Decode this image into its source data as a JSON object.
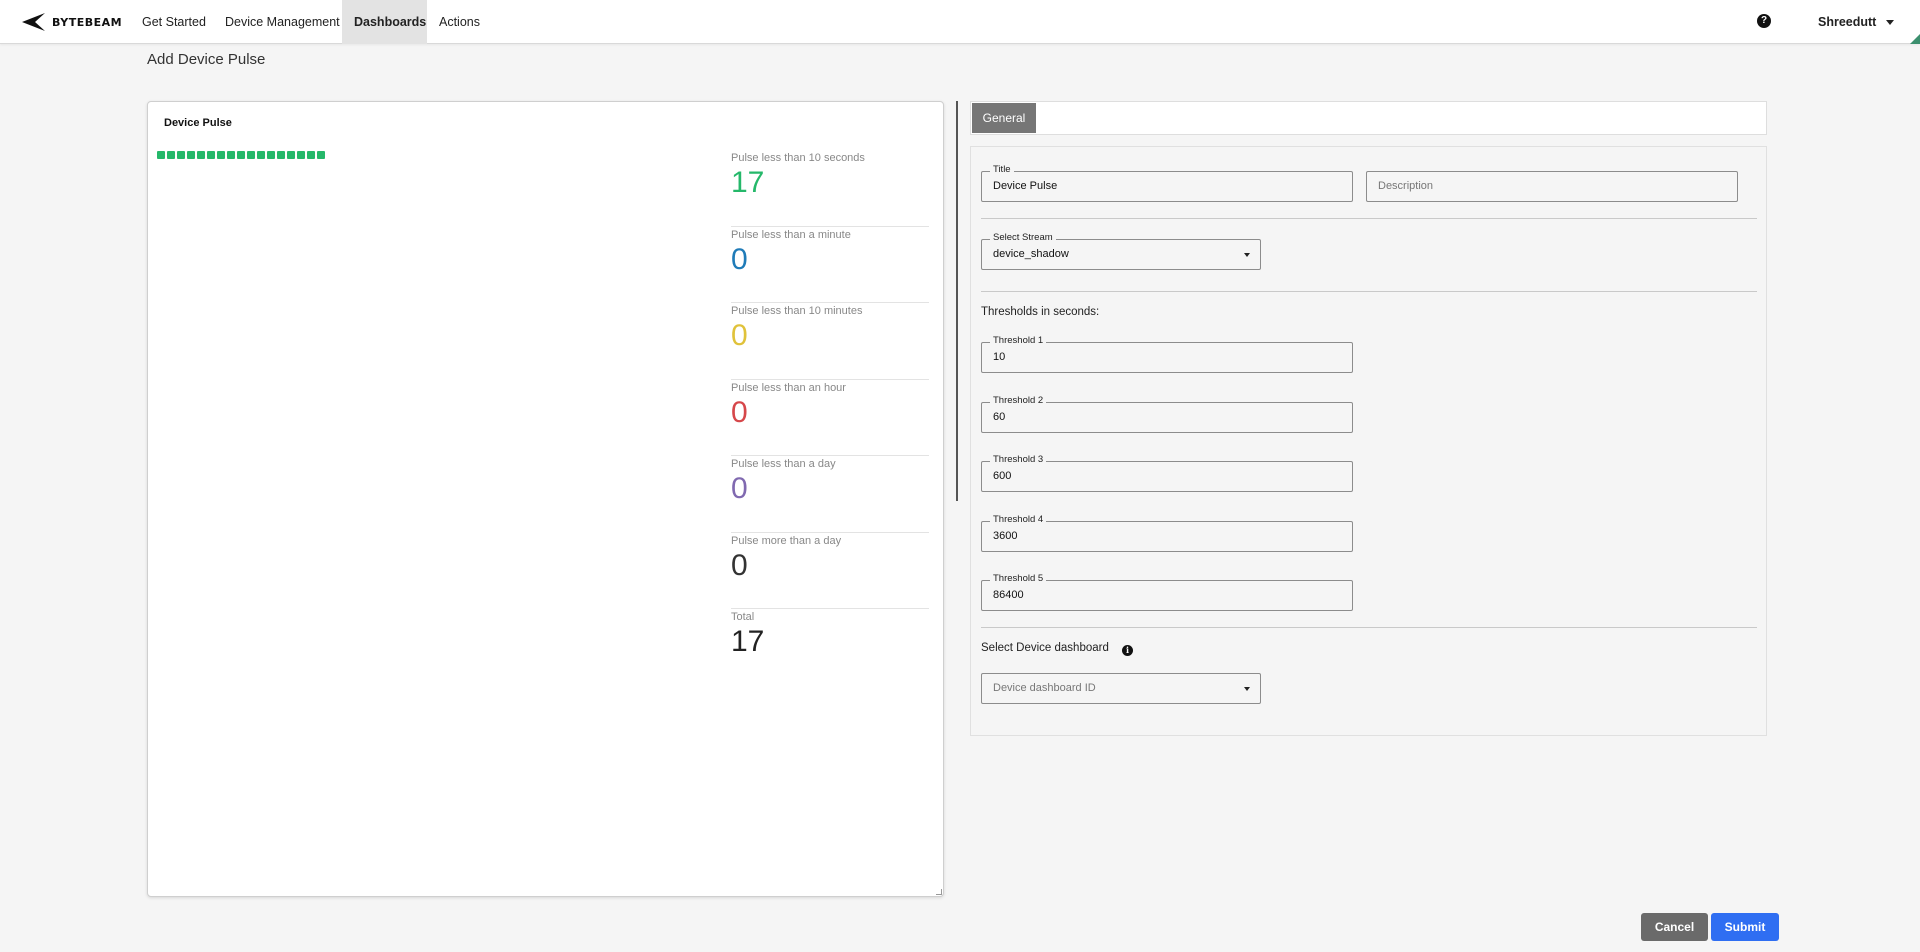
{
  "nav": {
    "logo_text": "BYTEBEAM",
    "items": [
      {
        "label": "Get Started"
      },
      {
        "label": "Device Management"
      },
      {
        "label": "Dashboards",
        "active": true
      },
      {
        "label": "Actions"
      }
    ],
    "help_icon": "question-circle-icon",
    "user": "Shreedutt"
  },
  "page": {
    "title": "Add Device Pulse"
  },
  "preview": {
    "title": "Device Pulse",
    "pulse_square_count": 17,
    "pulse_square_color": "#25b86a",
    "stats": [
      {
        "label": "Pulse less than 10 seconds",
        "value": "17",
        "color": "#25b86a"
      },
      {
        "label": "Pulse less than a minute",
        "value": "0",
        "color": "#1f7bb8"
      },
      {
        "label": "Pulse less than 10 minutes",
        "value": "0",
        "color": "#e0c23a"
      },
      {
        "label": "Pulse less than an hour",
        "value": "0",
        "color": "#d6474a"
      },
      {
        "label": "Pulse less than a day",
        "value": "0",
        "color": "#8069b0"
      },
      {
        "label": "Pulse more than a day",
        "value": "0",
        "color": "#333333"
      },
      {
        "label": "Total",
        "value": "17",
        "color": "#222222"
      }
    ]
  },
  "tabs": [
    {
      "label": "General",
      "active": true
    }
  ],
  "form": {
    "title": {
      "label": "Title",
      "value": "Device Pulse"
    },
    "description": {
      "placeholder": "Description"
    },
    "stream": {
      "label": "Select Stream",
      "value": "device_shadow"
    },
    "thresholds_heading": "Thresholds in seconds:",
    "thresholds": [
      {
        "label": "Threshold 1",
        "value": "10"
      },
      {
        "label": "Threshold 2",
        "value": "60"
      },
      {
        "label": "Threshold 3",
        "value": "600"
      },
      {
        "label": "Threshold 4",
        "value": "3600"
      },
      {
        "label": "Threshold 5",
        "value": "86400"
      }
    ],
    "device_dashboard_heading": "Select Device dashboard",
    "info_icon": "info-circle-icon",
    "device_dashboard": {
      "placeholder": "Device dashboard ID"
    }
  },
  "actions": {
    "cancel": "Cancel",
    "submit": "Submit"
  }
}
